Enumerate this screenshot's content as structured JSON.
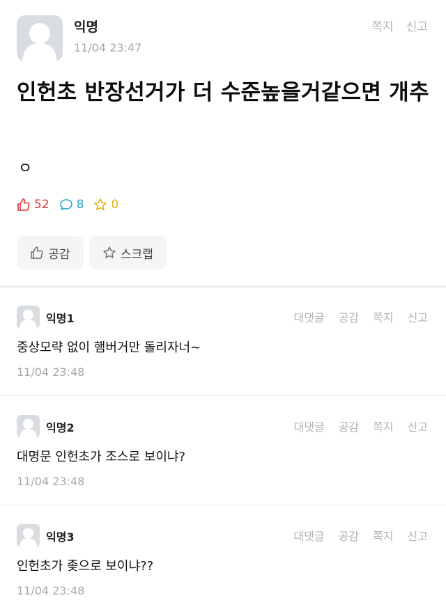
{
  "post": {
    "author": "익명",
    "time": "11/04 23:47",
    "actions": [
      "쪽지",
      "신고"
    ],
    "title": "인헌초 반장선거가 더 수준높을거같으면 개추",
    "body": "ㅇ",
    "stats": {
      "likes": "52",
      "comments": "8",
      "scraps": "0"
    },
    "like_button": "공감",
    "scrap_button": "스크랩"
  },
  "comment_actions": [
    "대댓글",
    "공감",
    "쪽지",
    "신고"
  ],
  "comments": [
    {
      "author": "익명1",
      "text": "중상모략 없이 햄버거만 돌리자너~",
      "time": "11/04 23:48"
    },
    {
      "author": "익명2",
      "text": "대명문 인헌초가 조스로 보이냐?",
      "time": "11/04 23:48"
    },
    {
      "author": "익명3",
      "text": "인헌초가 좆으로 보이냐??",
      "time": "11/04 23:48"
    }
  ],
  "colors": {
    "like": "#e0322d",
    "comment": "#1fa9c9",
    "scrap": "#e3b20a"
  }
}
